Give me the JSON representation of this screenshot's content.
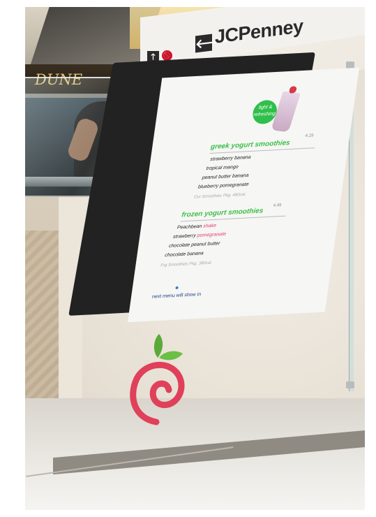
{
  "signage": {
    "store_name": "JCPenney",
    "arrow_glyph": "🡐",
    "up_glyph": "🡑",
    "red_badge": "🚫",
    "store_sign_partial": "DUNE"
  },
  "kiosk_menu": {
    "bubble_text": "light & refreshing",
    "sections": [
      {
        "title": "greek yogurt smoothies",
        "price": "4.29",
        "items": [
          "strawberry banana",
          "tropical mango",
          "peanut butter banana",
          "blueberry pomegranate"
        ],
        "note": "Our Smoothies Pkg. 480cal."
      },
      {
        "title": "frozen yogurt smoothies",
        "price": "4.49",
        "items": [
          "Peachbean shake",
          "strawberry pomegranate",
          "chocolate peanut butter",
          "chocolate banana"
        ],
        "note": "Frg Smoothies Pkg. 380cal."
      }
    ],
    "footer": "next menu will show in"
  },
  "colors": {
    "accent_green": "#3bbf48",
    "accent_pink": "#e53a7a",
    "logo_red": "#e0405a",
    "leaf_green": "#5aa93a"
  }
}
